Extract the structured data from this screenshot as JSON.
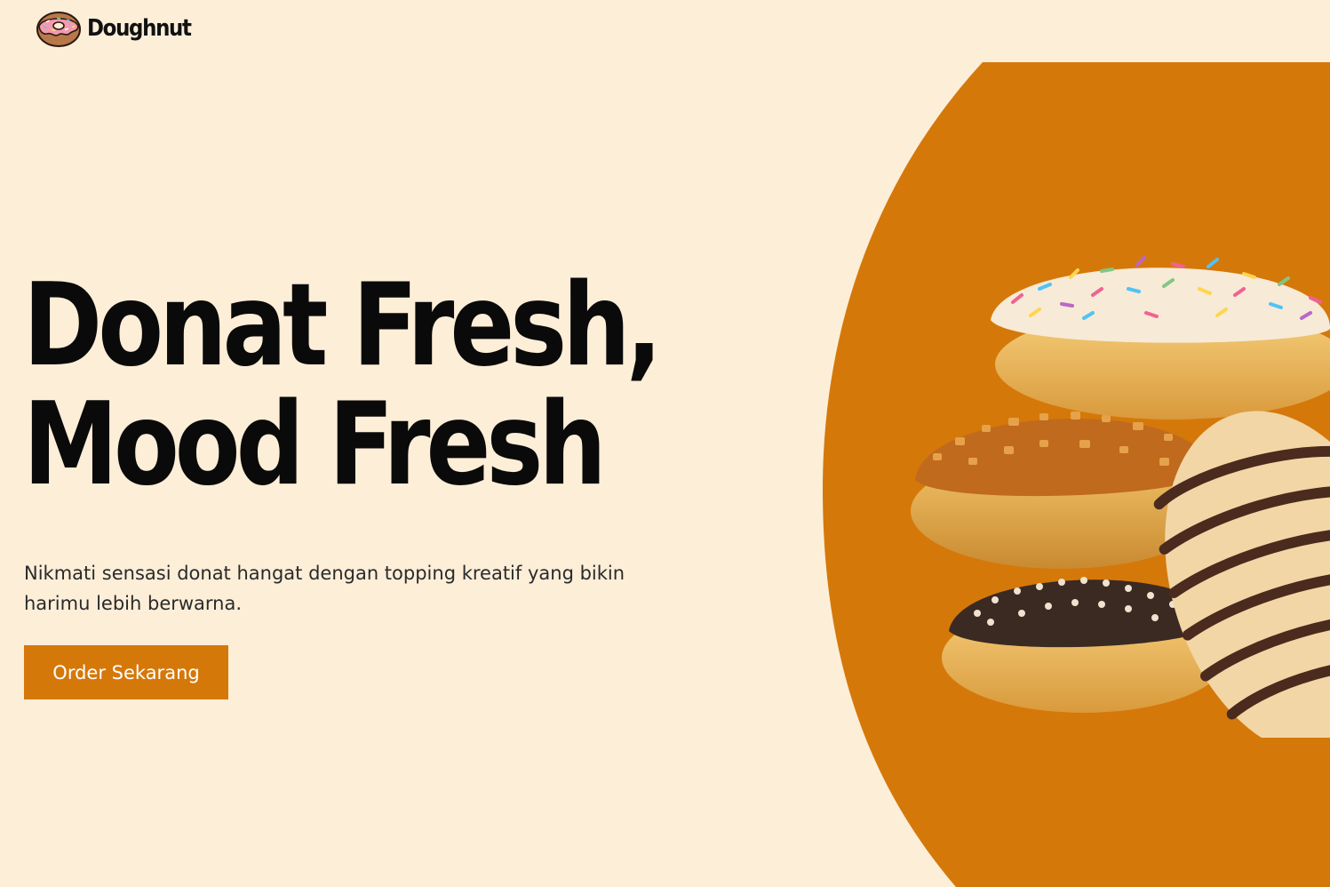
{
  "brand": {
    "name": "Doughnut",
    "logo_icon": "donut-icon"
  },
  "hero": {
    "headline_line_1": "Donat Fresh,",
    "headline_line_2": "Mood Fresh",
    "description": "Nikmati sensasi donat hangat dengan topping kreatif yang bikin harimu lebih berwarna.",
    "cta_label": "Order Sekarang",
    "image_alt": "Tumpukan donat dengan topping sprinkles, kacang, cokelat dan meses"
  },
  "colors": {
    "background": "#fdeed8",
    "accent": "#d5780a",
    "text": "#0a0a0a"
  }
}
